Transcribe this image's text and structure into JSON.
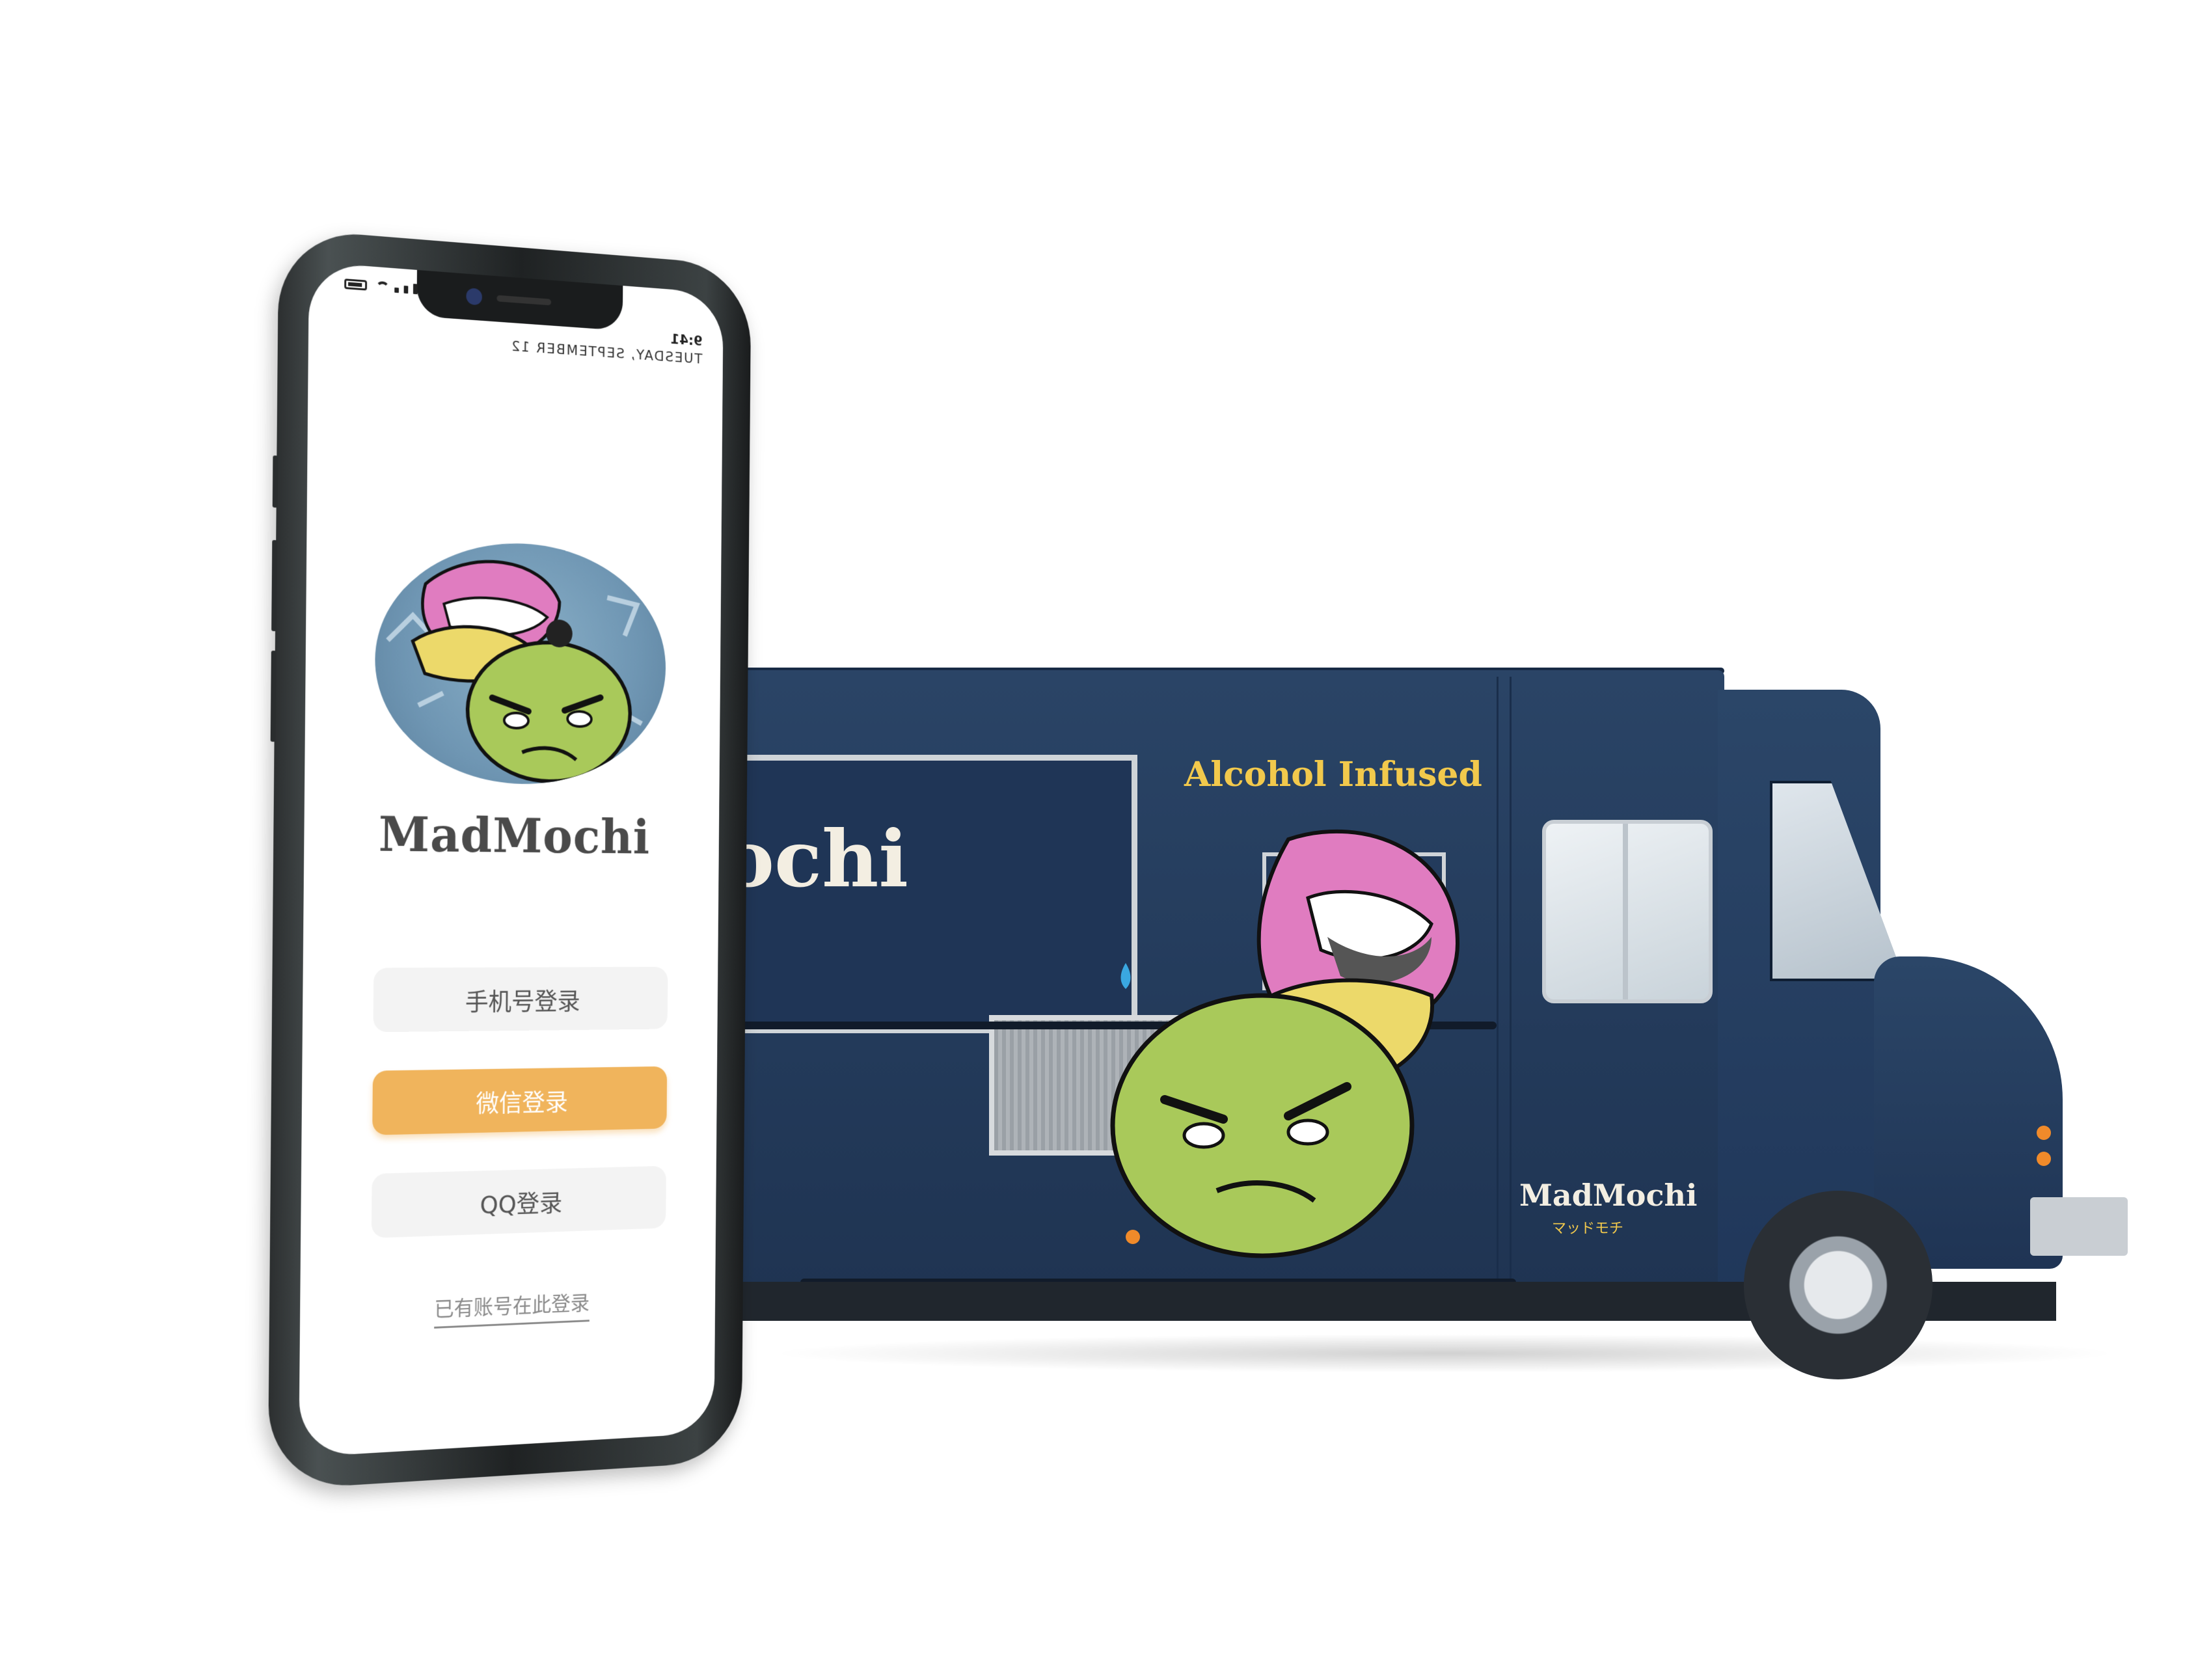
{
  "phone": {
    "status": {
      "time": "9:41",
      "date": "TUESDAY, SEPTEMBER 12"
    },
    "brand_name": "MadMochi",
    "buttons": {
      "phone_login": "手机号登录",
      "wechat_login": "微信登录",
      "qq_login": "QQ登录"
    },
    "existing_account_link": "已有账号在此登录"
  },
  "truck": {
    "slogan": "Alcohol Infused",
    "side_brand_partial": "ochi",
    "rear_brand": "MadMochi",
    "rear_brand_sub": "マッドモチ"
  },
  "colors": {
    "accent_orange": "#f0b45c",
    "truck_navy": "#233a5a",
    "truck_yellow": "#f2c94c",
    "mascot_green": "#a9c95a",
    "lips_pink": "#e07cc0"
  }
}
